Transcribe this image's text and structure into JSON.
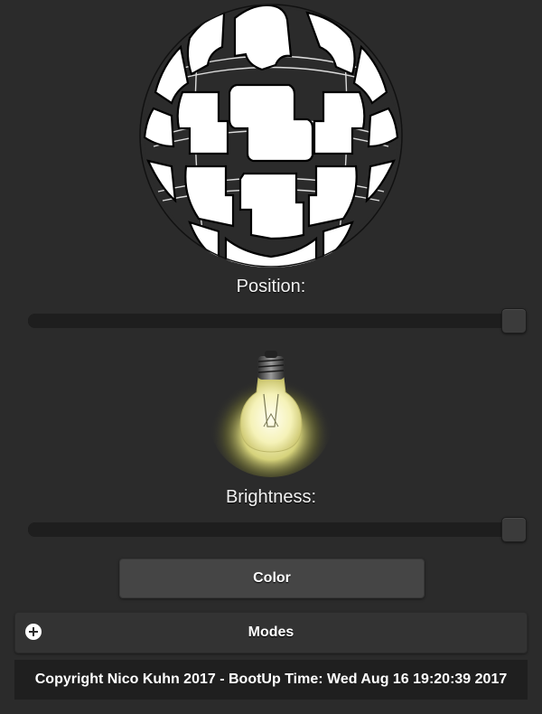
{
  "lamp": {
    "icon": "lamp-sphere-icon"
  },
  "position": {
    "label": "Position:",
    "value_fraction": 1.0
  },
  "bulb": {
    "icon": "light-bulb-icon",
    "glow_color": "#f4f08a"
  },
  "brightness": {
    "label": "Brightness:",
    "value_fraction": 1.0
  },
  "color_button": {
    "label": "Color"
  },
  "modes": {
    "label": "Modes",
    "icon": "plus-icon"
  },
  "footer": {
    "text": "Copyright Nico Kuhn 2017 - BootUp Time: Wed Aug 16 19:20:39 2017"
  }
}
